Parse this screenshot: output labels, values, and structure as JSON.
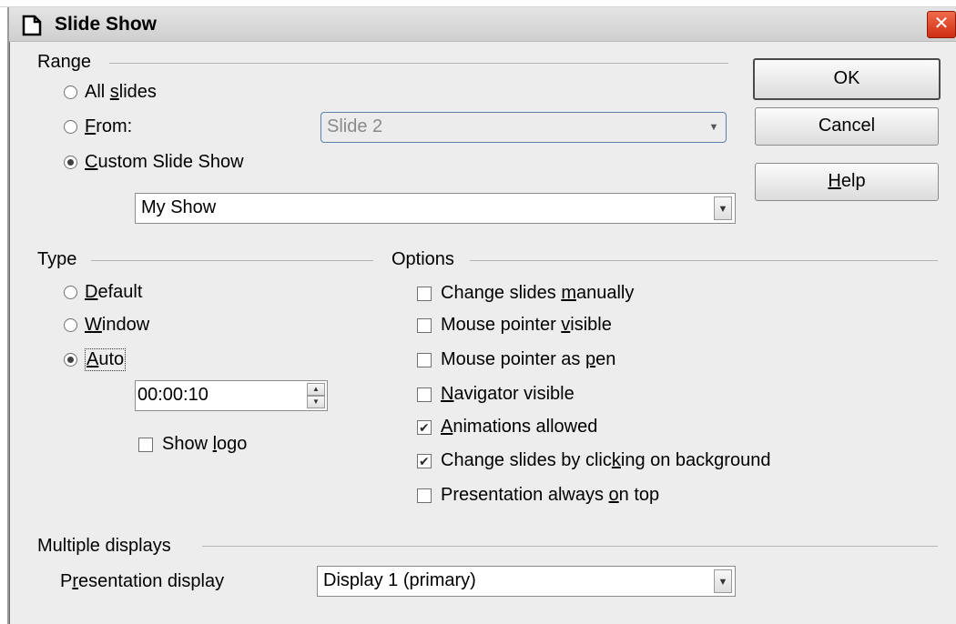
{
  "dialog": {
    "title": "Slide Show",
    "close_glyph": "✕",
    "title_icon": "document-icon"
  },
  "range": {
    "title": "Range",
    "all_slides": {
      "pre": "All ",
      "acc": "s",
      "post": "lides",
      "selected": false
    },
    "from": {
      "pre": "",
      "acc": "F",
      "post": "rom:",
      "selected": false
    },
    "from_select": {
      "value": "Slide 2",
      "disabled": true
    },
    "custom": {
      "pre": "",
      "acc": "C",
      "post": "ustom Slide Show",
      "selected": true
    },
    "custom_select": {
      "value": "My Show"
    }
  },
  "type": {
    "title": "Type",
    "default": {
      "pre": "",
      "acc": "D",
      "post": "efault",
      "selected": false
    },
    "window": {
      "pre": "",
      "acc": "W",
      "post": "indow",
      "selected": false
    },
    "auto": {
      "pre": "",
      "acc": "A",
      "post": "uto",
      "selected": true
    },
    "auto_time": "00:00:10",
    "show_logo": {
      "pre": "Show ",
      "acc": "l",
      "post": "ogo",
      "checked": false
    }
  },
  "options": {
    "title": "Options",
    "items": [
      {
        "pre": "Change slides ",
        "acc": "m",
        "post": "anually",
        "checked": false
      },
      {
        "pre": "Mouse pointer ",
        "acc": "v",
        "post": "isible",
        "checked": false
      },
      {
        "pre": "Mouse pointer as ",
        "acc": "p",
        "post": "en",
        "checked": false
      },
      {
        "pre": "",
        "acc": "N",
        "post": "avigator visible",
        "checked": false
      },
      {
        "pre": "",
        "acc": "A",
        "post": "nimations allowed",
        "checked": true
      },
      {
        "pre": "Change slides by clic",
        "acc": "k",
        "post": "ing on background",
        "checked": true
      },
      {
        "pre": "Presentation always ",
        "acc": "o",
        "post": "n top",
        "checked": false
      }
    ]
  },
  "multiple_displays": {
    "title": "Multiple displays",
    "label": {
      "pre": "P",
      "acc": "r",
      "post": "esentation display"
    },
    "select": {
      "value": "Display 1 (primary)"
    }
  },
  "buttons": {
    "ok": "OK",
    "cancel": "Cancel",
    "help": {
      "pre": "",
      "acc": "H",
      "post": "elp"
    }
  }
}
